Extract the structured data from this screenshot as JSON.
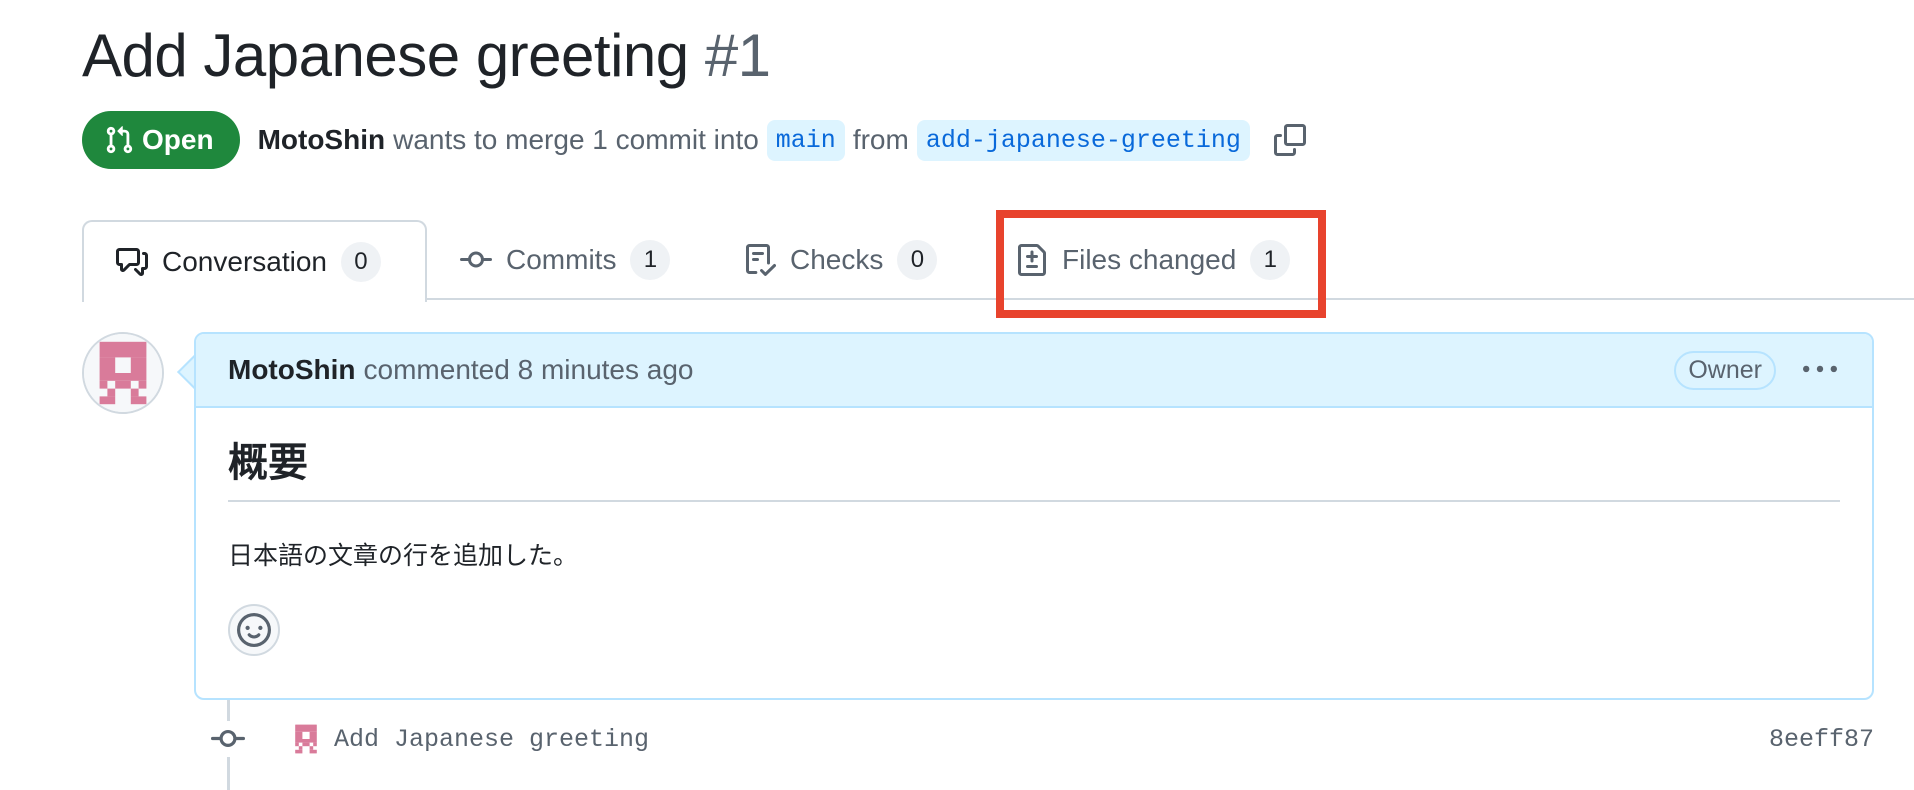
{
  "pull_request": {
    "title": "Add Japanese greeting",
    "number": "#1",
    "state": "Open",
    "author": "MotoShin",
    "merge_text": "wants to merge 1 commit into",
    "base_branch": "main",
    "from_text": "from",
    "head_branch": "add-japanese-greeting"
  },
  "tabs": [
    {
      "label": "Conversation",
      "count": "0",
      "icon": "comment-discussion-icon",
      "selected": true
    },
    {
      "label": "Commits",
      "count": "1",
      "icon": "git-commit-icon"
    },
    {
      "label": "Checks",
      "count": "0",
      "icon": "checklist-icon"
    },
    {
      "label": "Files changed",
      "count": "1",
      "icon": "file-diff-icon",
      "highlighted": true
    }
  ],
  "comment": {
    "author": "MotoShin",
    "action": "commented 8 minutes ago",
    "role_badge": "Owner",
    "heading": "概要",
    "text": "日本語の文章の行を追加した。"
  },
  "commit": {
    "message": "Add Japanese greeting",
    "sha": "8eeff87"
  },
  "colors": {
    "open_green": "#1f883d",
    "link_blue": "#0969da",
    "comment_header_bg": "#ddf4ff",
    "avatar_pink": "#d97b9a",
    "highlight_red": "#e8432d"
  }
}
